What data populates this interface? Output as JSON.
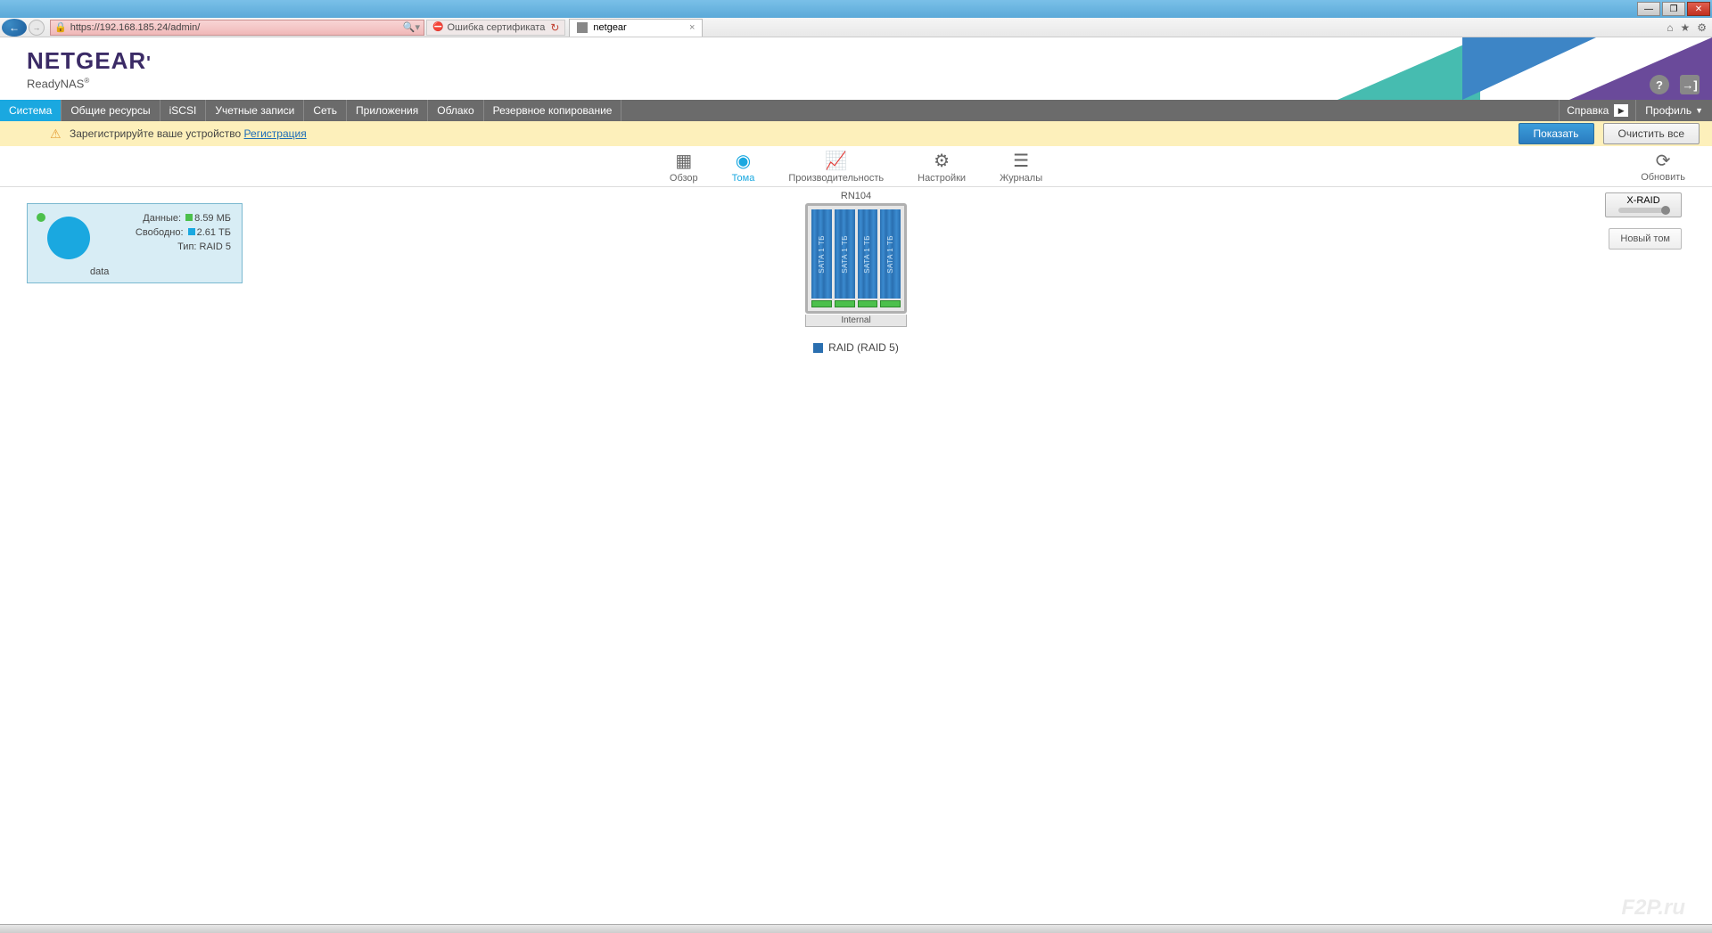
{
  "browser": {
    "url": "https://192.168.185.24/admin/",
    "cert_error": "Ошибка сертификата",
    "tab_title": "netgear"
  },
  "brand": {
    "logo": "NETGEAR",
    "subtitle": "ReadyNAS"
  },
  "nav": {
    "items": [
      "Система",
      "Общие ресурсы",
      "iSCSI",
      "Учетные записи",
      "Сеть",
      "Приложения",
      "Облако",
      "Резервное копирование"
    ],
    "help": "Справка",
    "profile": "Профиль"
  },
  "notice": {
    "text": "Зарегистрируйте ваше устройство ",
    "link": "Регистрация",
    "show": "Показать",
    "clear_all": "Очистить все"
  },
  "subnav": {
    "overview": "Обзор",
    "volumes": "Тома",
    "performance": "Производительность",
    "settings": "Настройки",
    "logs": "Журналы",
    "refresh": "Обновить"
  },
  "volume": {
    "data_label": "Данные:",
    "data_value": "8.59 МБ",
    "free_label": "Свободно:",
    "free_value": "2.61 ТБ",
    "type_label": "Тип:",
    "type_value": "RAID 5",
    "name": "data"
  },
  "device": {
    "model": "RN104",
    "drive_label": "SATA 1 ТБ",
    "location": "Internal",
    "raid_legend": "RAID (RAID 5)"
  },
  "right": {
    "xraid": "X-RAID",
    "new_volume": "Новый том"
  }
}
